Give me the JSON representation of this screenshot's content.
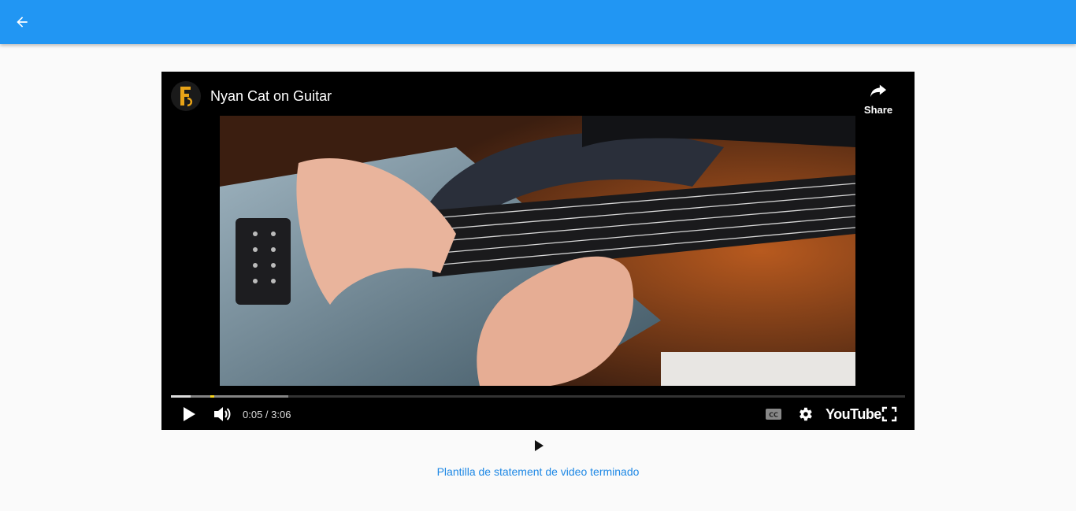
{
  "appbar": {
    "background": "#2196f3",
    "back_icon": "arrow-back-icon"
  },
  "player": {
    "channel_logo_icon": "channel-logo-icon",
    "title": "Nyan Cat on Guitar",
    "share_label": "Share",
    "share_icon": "share-arrow-icon",
    "progress_loaded_fraction": 0.16,
    "progress_played_fraction": 0.027,
    "time_current": "0:05",
    "time_separator": " / ",
    "time_total": "3:06",
    "icons": {
      "play": "play-icon",
      "volume": "volume-icon",
      "captions": "closed-captions-icon",
      "settings": "gear-icon",
      "fullscreen": "fullscreen-icon"
    },
    "brand_label": "YouTube"
  },
  "page": {
    "play_icon": "play-icon",
    "link_text": "Plantilla de statement de video terminado",
    "link_color": "#1e88e5"
  }
}
